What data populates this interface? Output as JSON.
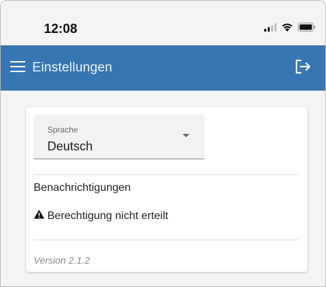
{
  "status_bar": {
    "time": "12:08",
    "icons": [
      "cellular-signal-icon",
      "wifi-icon",
      "battery-icon"
    ]
  },
  "app_bar": {
    "title": "Einstellungen",
    "background_color": "#3776b2",
    "menu_icon": "hamburger-menu-icon",
    "logout_icon": "logout-icon"
  },
  "settings": {
    "language": {
      "label": "Sprache",
      "value": "Deutsch"
    },
    "notifications": {
      "title": "Benachrichtigungen",
      "warning_icon": "warning-icon",
      "warning_text": "Berechtigung nicht erteilt"
    },
    "version": "Version 2.1.2"
  }
}
